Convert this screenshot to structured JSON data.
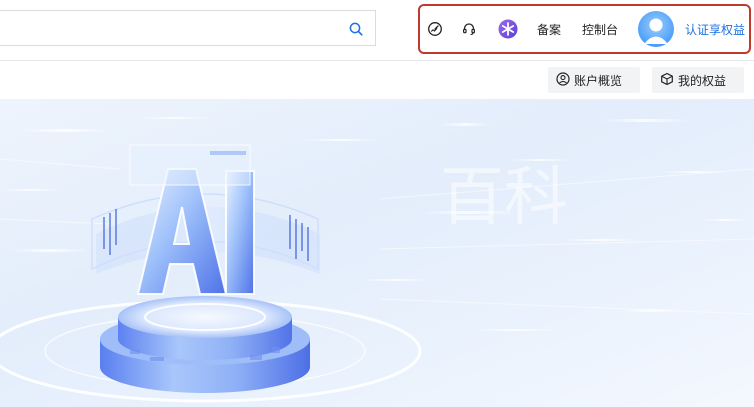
{
  "search": {
    "value": "",
    "placeholder": ""
  },
  "header": {
    "tools": [
      {
        "name": "dashboard-icon"
      },
      {
        "name": "headset-icon"
      },
      {
        "name": "ai-assistant-icon"
      }
    ],
    "beian_label": "备案",
    "console_label": "控制台",
    "verify_label": "认证享权益"
  },
  "subnav": {
    "account_overview": "账户概览",
    "my_benefits": "我的权益"
  },
  "banner": {
    "headline": "AI",
    "watermark": "百科"
  },
  "colors": {
    "highlight_border": "#c0392b",
    "link_blue": "#1e6fe0",
    "ai_purple": "#7b4fe0"
  }
}
